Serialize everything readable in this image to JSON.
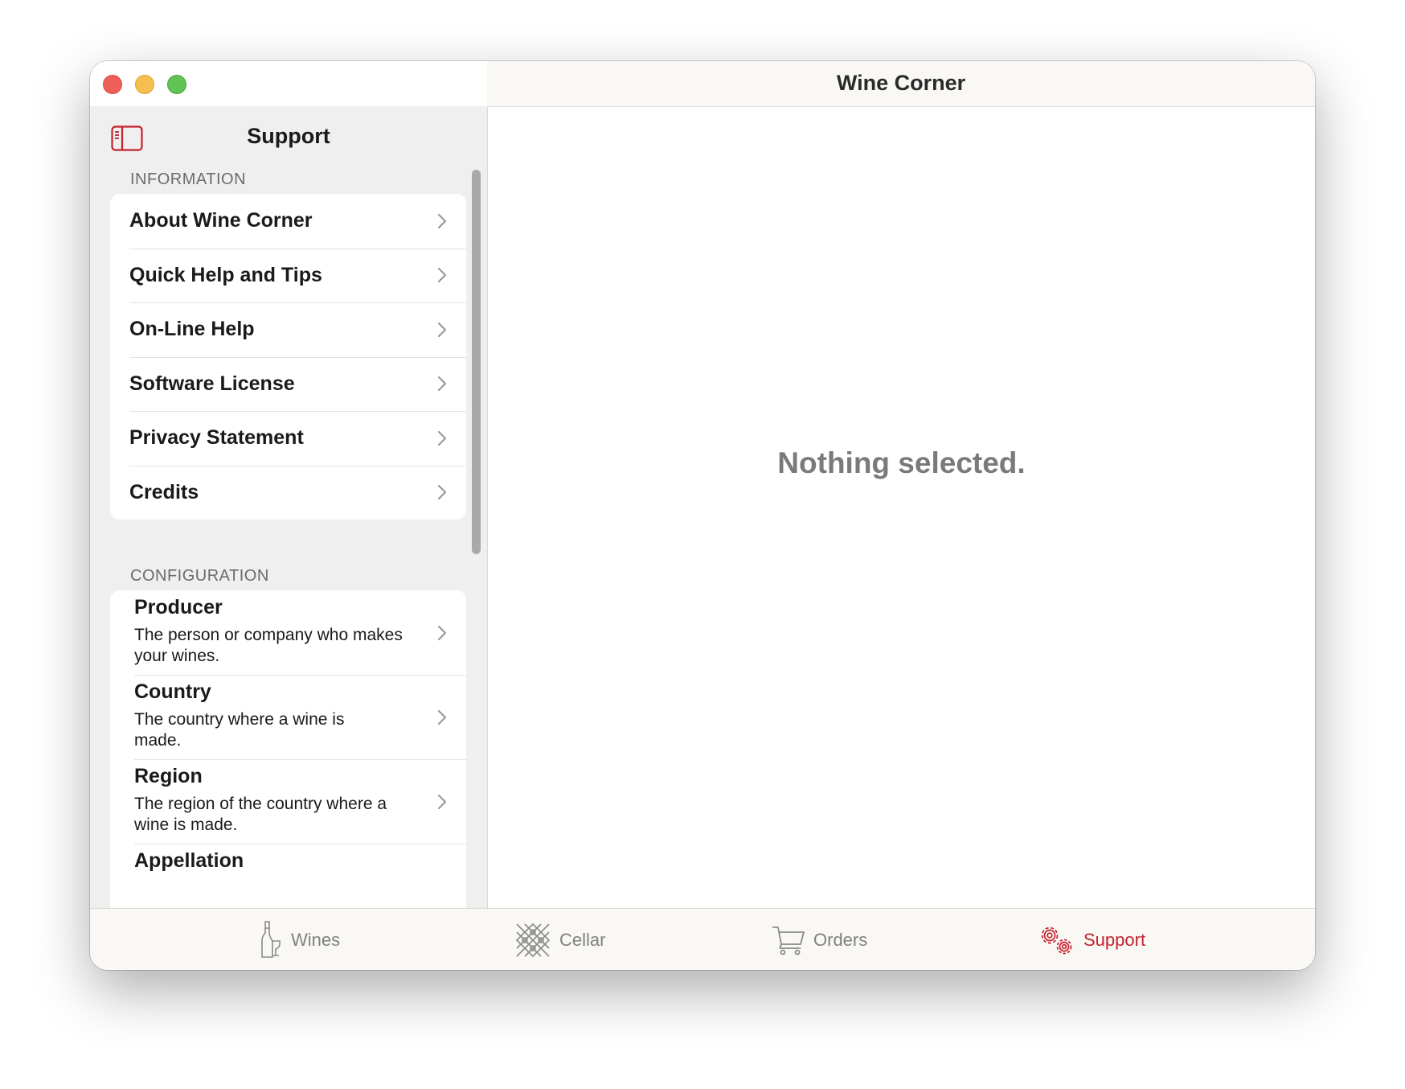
{
  "window": {
    "title": "Wine Corner"
  },
  "sidebar": {
    "title": "Support",
    "toggle_icon": "sidebar-toggle-icon",
    "information": {
      "header": "INFORMATION",
      "items": [
        {
          "label": "About Wine Corner"
        },
        {
          "label": "Quick Help and Tips"
        },
        {
          "label": "On-Line Help"
        },
        {
          "label": "Software License"
        },
        {
          "label": "Privacy Statement"
        },
        {
          "label": "Credits"
        }
      ]
    },
    "configuration": {
      "header": "CONFIGURATION",
      "items": [
        {
          "title": "Producer",
          "description": "The person or company who makes your wines."
        },
        {
          "title": "Country",
          "description": "The country where a wine is made."
        },
        {
          "title": "Region",
          "description": "The region of the country where a wine is made."
        },
        {
          "title": "Appellation",
          "description": ""
        }
      ]
    }
  },
  "detail": {
    "empty_message": "Nothing selected."
  },
  "tabbar": {
    "tabs": [
      {
        "label": "Wines",
        "icon": "wine-bottle-icon",
        "active": false
      },
      {
        "label": "Cellar",
        "icon": "wine-rack-icon",
        "active": false
      },
      {
        "label": "Orders",
        "icon": "cart-icon",
        "active": false
      },
      {
        "label": "Support",
        "icon": "gears-icon",
        "active": true
      }
    ]
  },
  "colors": {
    "accent": "#c2222e",
    "inactive_tab": "#808080",
    "sidebar_bg": "#efefef",
    "close": "#ee5f57",
    "minimize": "#f5be4f",
    "zoom": "#5fc454"
  }
}
